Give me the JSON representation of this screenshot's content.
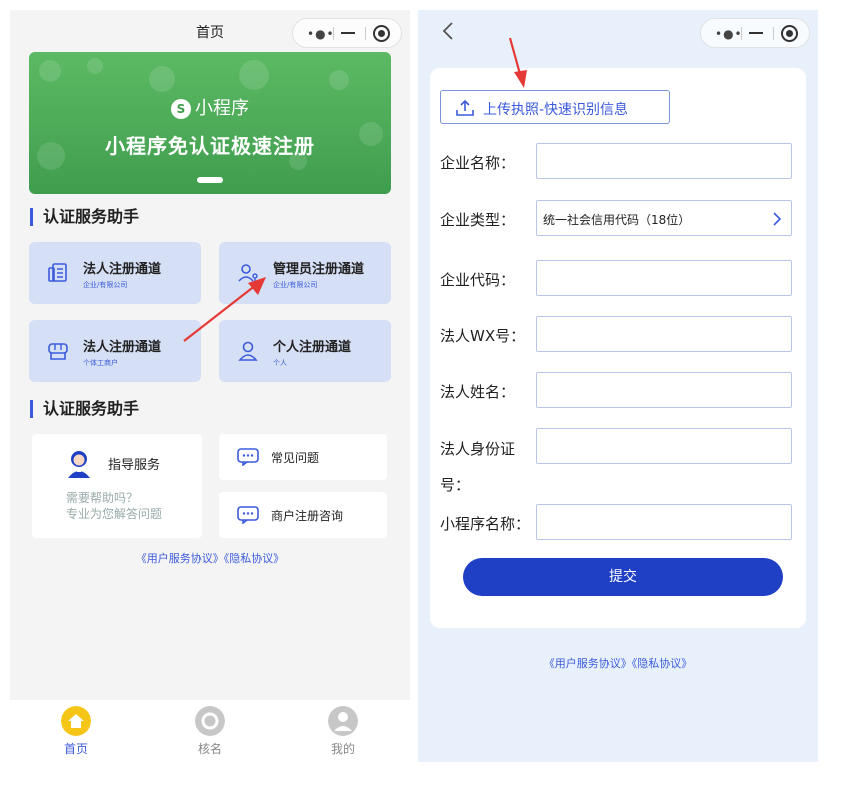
{
  "left_screen": {
    "nav_title": "首页",
    "banner": {
      "logo_text": "小程序",
      "title": "小程序免认证极速注册"
    },
    "section1_title": "认证服务助手",
    "cards": [
      {
        "title": "法人注册通道",
        "sub": "企业/有限公司",
        "icon": "document-icon"
      },
      {
        "title": "管理员注册通道",
        "sub": "企业/有限公司",
        "icon": "admin-user-icon"
      },
      {
        "title": "法人注册通道",
        "sub": "个体工商户",
        "icon": "shop-icon"
      },
      {
        "title": "个人注册通道",
        "sub": "个人",
        "icon": "person-icon"
      }
    ],
    "section2_title": "认证服务助手",
    "services": {
      "guide_label": "指导服务",
      "help_line1": "需要帮助吗？",
      "help_line2": "专业为您解答问题",
      "faq_label": "常见问题",
      "consult_label": "商户注册咨询"
    },
    "agreement": "《用户服务协议》《隐私协议》",
    "tabs": [
      {
        "label": "首页",
        "icon": "home-icon",
        "active": true
      },
      {
        "label": "核名",
        "icon": "check-name-icon",
        "active": false
      },
      {
        "label": "我的",
        "icon": "profile-icon",
        "active": false
      }
    ]
  },
  "right_screen": {
    "upload_label": "上传执照-快速识别信息",
    "fields": {
      "company_name": "企业名称：",
      "company_type": "企业类型：",
      "company_type_value": "统一社会信用代码（18位）",
      "company_code": "企业代码：",
      "legal_wx": "法人WX号：",
      "legal_name": "法人姓名：",
      "legal_id_line1": "法人身份证",
      "legal_id_line2": "号：",
      "mini_program_name": "小程序名称："
    },
    "submit_label": "提交",
    "agreement": "《用户服务协议》《隐私协议》"
  },
  "colors": {
    "accent_blue": "#1f40c4",
    "card_bg": "#d5dff5",
    "banner_green": "#4caf50",
    "annotation_red": "#e53935"
  }
}
